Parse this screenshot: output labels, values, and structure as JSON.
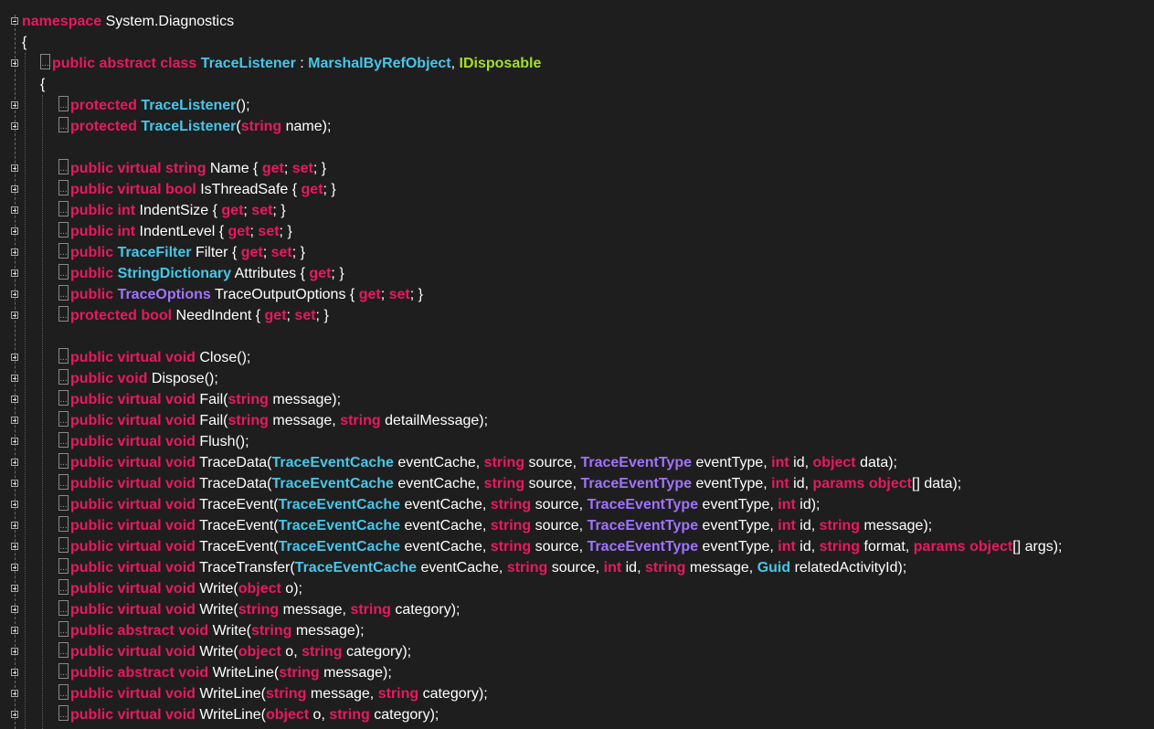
{
  "editor": {
    "background": "#1e1e1e",
    "colors": {
      "keyword": "#e8195f",
      "type": "#47c6e9",
      "enum_type": "#a073ff",
      "interface": "#a3df27",
      "plain": "#ffffff"
    },
    "lines": [
      {
        "fold": "minus",
        "indent": 0,
        "collapsed": false,
        "tokens": [
          [
            "k",
            "namespace"
          ],
          [
            "p",
            " System.Diagnostics"
          ]
        ]
      },
      {
        "fold": "",
        "indent": 0,
        "collapsed": false,
        "tokens": [
          [
            "p",
            "{"
          ]
        ]
      },
      {
        "fold": "plus",
        "indent": 1,
        "collapsed": true,
        "tokens": [
          [
            "k",
            "public abstract class "
          ],
          [
            "t",
            "TraceListener"
          ],
          [
            "p",
            " : "
          ],
          [
            "t",
            "MarshalByRefObject"
          ],
          [
            "p",
            ", "
          ],
          [
            "i",
            "IDisposable"
          ]
        ]
      },
      {
        "fold": "",
        "indent": 1,
        "collapsed": false,
        "tokens": [
          [
            "p",
            "{"
          ]
        ]
      },
      {
        "fold": "plus",
        "indent": 2,
        "collapsed": true,
        "tokens": [
          [
            "k",
            "protected "
          ],
          [
            "t",
            "TraceListener"
          ],
          [
            "p",
            "();"
          ]
        ]
      },
      {
        "fold": "plus",
        "indent": 2,
        "collapsed": true,
        "tokens": [
          [
            "k",
            "protected "
          ],
          [
            "t",
            "TraceListener"
          ],
          [
            "p",
            "("
          ],
          [
            "k",
            "string"
          ],
          [
            "p",
            " name);"
          ]
        ]
      },
      {
        "fold": "",
        "indent": 2,
        "collapsed": false,
        "tokens": []
      },
      {
        "fold": "plus",
        "indent": 2,
        "collapsed": true,
        "tokens": [
          [
            "k",
            "public virtual string"
          ],
          [
            "p",
            " Name { "
          ],
          [
            "k",
            "get"
          ],
          [
            "p",
            "; "
          ],
          [
            "k",
            "set"
          ],
          [
            "p",
            "; }"
          ]
        ]
      },
      {
        "fold": "plus",
        "indent": 2,
        "collapsed": true,
        "tokens": [
          [
            "k",
            "public virtual bool"
          ],
          [
            "p",
            " IsThreadSafe { "
          ],
          [
            "k",
            "get"
          ],
          [
            "p",
            "; }"
          ]
        ]
      },
      {
        "fold": "plus",
        "indent": 2,
        "collapsed": true,
        "tokens": [
          [
            "k",
            "public int"
          ],
          [
            "p",
            " IndentSize { "
          ],
          [
            "k",
            "get"
          ],
          [
            "p",
            "; "
          ],
          [
            "k",
            "set"
          ],
          [
            "p",
            "; }"
          ]
        ]
      },
      {
        "fold": "plus",
        "indent": 2,
        "collapsed": true,
        "tokens": [
          [
            "k",
            "public int"
          ],
          [
            "p",
            " IndentLevel { "
          ],
          [
            "k",
            "get"
          ],
          [
            "p",
            "; "
          ],
          [
            "k",
            "set"
          ],
          [
            "p",
            "; }"
          ]
        ]
      },
      {
        "fold": "plus",
        "indent": 2,
        "collapsed": true,
        "tokens": [
          [
            "k",
            "public "
          ],
          [
            "t",
            "TraceFilter"
          ],
          [
            "p",
            " Filter { "
          ],
          [
            "k",
            "get"
          ],
          [
            "p",
            "; "
          ],
          [
            "k",
            "set"
          ],
          [
            "p",
            "; }"
          ]
        ]
      },
      {
        "fold": "plus",
        "indent": 2,
        "collapsed": true,
        "tokens": [
          [
            "k",
            "public "
          ],
          [
            "t",
            "StringDictionary"
          ],
          [
            "p",
            " Attributes { "
          ],
          [
            "k",
            "get"
          ],
          [
            "p",
            "; }"
          ]
        ]
      },
      {
        "fold": "plus",
        "indent": 2,
        "collapsed": true,
        "tokens": [
          [
            "k",
            "public "
          ],
          [
            "e",
            "TraceOptions"
          ],
          [
            "p",
            " TraceOutputOptions { "
          ],
          [
            "k",
            "get"
          ],
          [
            "p",
            "; "
          ],
          [
            "k",
            "set"
          ],
          [
            "p",
            "; }"
          ]
        ]
      },
      {
        "fold": "plus",
        "indent": 2,
        "collapsed": true,
        "tokens": [
          [
            "k",
            "protected bool"
          ],
          [
            "p",
            " NeedIndent { "
          ],
          [
            "k",
            "get"
          ],
          [
            "p",
            "; "
          ],
          [
            "k",
            "set"
          ],
          [
            "p",
            "; }"
          ]
        ]
      },
      {
        "fold": "",
        "indent": 2,
        "collapsed": false,
        "tokens": []
      },
      {
        "fold": "plus",
        "indent": 2,
        "collapsed": true,
        "tokens": [
          [
            "k",
            "public virtual void"
          ],
          [
            "p",
            " Close();"
          ]
        ]
      },
      {
        "fold": "plus",
        "indent": 2,
        "collapsed": true,
        "tokens": [
          [
            "k",
            "public void"
          ],
          [
            "p",
            " Dispose();"
          ]
        ]
      },
      {
        "fold": "plus",
        "indent": 2,
        "collapsed": true,
        "tokens": [
          [
            "k",
            "public virtual void"
          ],
          [
            "p",
            " Fail("
          ],
          [
            "k",
            "string"
          ],
          [
            "p",
            " message);"
          ]
        ]
      },
      {
        "fold": "plus",
        "indent": 2,
        "collapsed": true,
        "tokens": [
          [
            "k",
            "public virtual void"
          ],
          [
            "p",
            " Fail("
          ],
          [
            "k",
            "string"
          ],
          [
            "p",
            " message, "
          ],
          [
            "k",
            "string"
          ],
          [
            "p",
            " detailMessage);"
          ]
        ]
      },
      {
        "fold": "plus",
        "indent": 2,
        "collapsed": true,
        "tokens": [
          [
            "k",
            "public virtual void"
          ],
          [
            "p",
            " Flush();"
          ]
        ]
      },
      {
        "fold": "plus",
        "indent": 2,
        "collapsed": true,
        "tokens": [
          [
            "k",
            "public virtual void"
          ],
          [
            "p",
            " TraceData("
          ],
          [
            "t",
            "TraceEventCache"
          ],
          [
            "p",
            " eventCache, "
          ],
          [
            "k",
            "string"
          ],
          [
            "p",
            " source, "
          ],
          [
            "e",
            "TraceEventType"
          ],
          [
            "p",
            " eventType, "
          ],
          [
            "k",
            "int"
          ],
          [
            "p",
            " id, "
          ],
          [
            "k",
            "object"
          ],
          [
            "p",
            " data);"
          ]
        ]
      },
      {
        "fold": "plus",
        "indent": 2,
        "collapsed": true,
        "tokens": [
          [
            "k",
            "public virtual void"
          ],
          [
            "p",
            " TraceData("
          ],
          [
            "t",
            "TraceEventCache"
          ],
          [
            "p",
            " eventCache, "
          ],
          [
            "k",
            "string"
          ],
          [
            "p",
            " source, "
          ],
          [
            "e",
            "TraceEventType"
          ],
          [
            "p",
            " eventType, "
          ],
          [
            "k",
            "int"
          ],
          [
            "p",
            " id, "
          ],
          [
            "k",
            "params object"
          ],
          [
            "p",
            "[] data);"
          ]
        ]
      },
      {
        "fold": "plus",
        "indent": 2,
        "collapsed": true,
        "tokens": [
          [
            "k",
            "public virtual void"
          ],
          [
            "p",
            " TraceEvent("
          ],
          [
            "t",
            "TraceEventCache"
          ],
          [
            "p",
            " eventCache, "
          ],
          [
            "k",
            "string"
          ],
          [
            "p",
            " source, "
          ],
          [
            "e",
            "TraceEventType"
          ],
          [
            "p",
            " eventType, "
          ],
          [
            "k",
            "int"
          ],
          [
            "p",
            " id);"
          ]
        ]
      },
      {
        "fold": "plus",
        "indent": 2,
        "collapsed": true,
        "tokens": [
          [
            "k",
            "public virtual void"
          ],
          [
            "p",
            " TraceEvent("
          ],
          [
            "t",
            "TraceEventCache"
          ],
          [
            "p",
            " eventCache, "
          ],
          [
            "k",
            "string"
          ],
          [
            "p",
            " source, "
          ],
          [
            "e",
            "TraceEventType"
          ],
          [
            "p",
            " eventType, "
          ],
          [
            "k",
            "int"
          ],
          [
            "p",
            " id, "
          ],
          [
            "k",
            "string"
          ],
          [
            "p",
            " message);"
          ]
        ]
      },
      {
        "fold": "plus",
        "indent": 2,
        "collapsed": true,
        "tokens": [
          [
            "k",
            "public virtual void"
          ],
          [
            "p",
            " TraceEvent("
          ],
          [
            "t",
            "TraceEventCache"
          ],
          [
            "p",
            " eventCache, "
          ],
          [
            "k",
            "string"
          ],
          [
            "p",
            " source, "
          ],
          [
            "e",
            "TraceEventType"
          ],
          [
            "p",
            " eventType, "
          ],
          [
            "k",
            "int"
          ],
          [
            "p",
            " id, "
          ],
          [
            "k",
            "string"
          ],
          [
            "p",
            " format, "
          ],
          [
            "k",
            "params object"
          ],
          [
            "p",
            "[] args);"
          ]
        ]
      },
      {
        "fold": "plus",
        "indent": 2,
        "collapsed": true,
        "tokens": [
          [
            "k",
            "public virtual void"
          ],
          [
            "p",
            " TraceTransfer("
          ],
          [
            "t",
            "TraceEventCache"
          ],
          [
            "p",
            " eventCache, "
          ],
          [
            "k",
            "string"
          ],
          [
            "p",
            " source, "
          ],
          [
            "k",
            "int"
          ],
          [
            "p",
            " id, "
          ],
          [
            "k",
            "string"
          ],
          [
            "p",
            " message, "
          ],
          [
            "t",
            "Guid"
          ],
          [
            "p",
            " relatedActivityId);"
          ]
        ]
      },
      {
        "fold": "plus",
        "indent": 2,
        "collapsed": true,
        "tokens": [
          [
            "k",
            "public virtual void"
          ],
          [
            "p",
            " Write("
          ],
          [
            "k",
            "object"
          ],
          [
            "p",
            " o);"
          ]
        ]
      },
      {
        "fold": "plus",
        "indent": 2,
        "collapsed": true,
        "tokens": [
          [
            "k",
            "public virtual void"
          ],
          [
            "p",
            " Write("
          ],
          [
            "k",
            "string"
          ],
          [
            "p",
            " message, "
          ],
          [
            "k",
            "string"
          ],
          [
            "p",
            " category);"
          ]
        ]
      },
      {
        "fold": "plus",
        "indent": 2,
        "collapsed": true,
        "tokens": [
          [
            "k",
            "public abstract void"
          ],
          [
            "p",
            " Write("
          ],
          [
            "k",
            "string"
          ],
          [
            "p",
            " message);"
          ]
        ]
      },
      {
        "fold": "plus",
        "indent": 2,
        "collapsed": true,
        "tokens": [
          [
            "k",
            "public virtual void"
          ],
          [
            "p",
            " Write("
          ],
          [
            "k",
            "object"
          ],
          [
            "p",
            " o, "
          ],
          [
            "k",
            "string"
          ],
          [
            "p",
            " category);"
          ]
        ]
      },
      {
        "fold": "plus",
        "indent": 2,
        "collapsed": true,
        "tokens": [
          [
            "k",
            "public abstract void"
          ],
          [
            "p",
            " WriteLine("
          ],
          [
            "k",
            "string"
          ],
          [
            "p",
            " message);"
          ]
        ]
      },
      {
        "fold": "plus",
        "indent": 2,
        "collapsed": true,
        "tokens": [
          [
            "k",
            "public virtual void"
          ],
          [
            "p",
            " WriteLine("
          ],
          [
            "k",
            "string"
          ],
          [
            "p",
            " message, "
          ],
          [
            "k",
            "string"
          ],
          [
            "p",
            " category);"
          ]
        ]
      },
      {
        "fold": "plus",
        "indent": 2,
        "collapsed": true,
        "tokens": [
          [
            "k",
            "public virtual void"
          ],
          [
            "p",
            " WriteLine("
          ],
          [
            "k",
            "object"
          ],
          [
            "p",
            " o, "
          ],
          [
            "k",
            "string"
          ],
          [
            "p",
            " category);"
          ]
        ]
      }
    ]
  }
}
